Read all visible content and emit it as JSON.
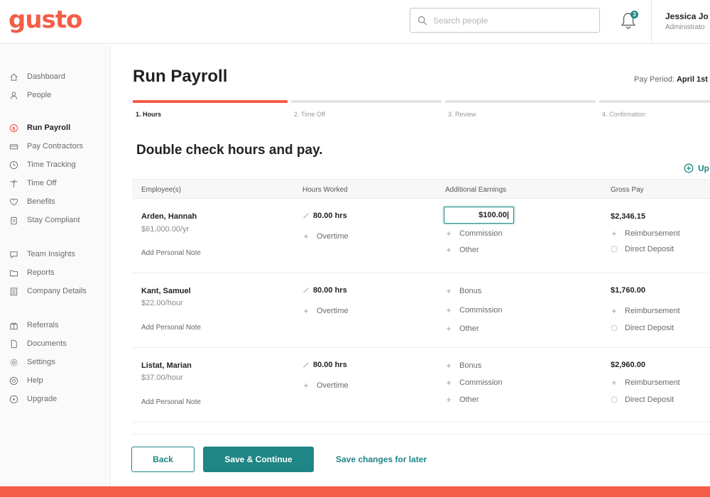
{
  "brand": {
    "logo_text": "gusto",
    "accent": "#f45d48",
    "primary": "#1f8585"
  },
  "header": {
    "search_placeholder": "Search people",
    "notification_count": "3",
    "user_name": "Jessica Jo",
    "user_role": "Administrato"
  },
  "sidebar": {
    "items": [
      {
        "label": "Dashboard",
        "icon": "home-icon"
      },
      {
        "label": "People",
        "icon": "person-icon"
      },
      {
        "label": "Run Payroll",
        "icon": "dollar-icon",
        "active": true
      },
      {
        "label": "Pay Contractors",
        "icon": "card-icon"
      },
      {
        "label": "Time Tracking",
        "icon": "clock-icon"
      },
      {
        "label": "Time Off",
        "icon": "palm-icon"
      },
      {
        "label": "Benefits",
        "icon": "heart-icon"
      },
      {
        "label": "Stay Compliant",
        "icon": "clipboard-icon"
      },
      {
        "label": "Team Insights",
        "icon": "chat-icon"
      },
      {
        "label": "Reports",
        "icon": "folder-icon"
      },
      {
        "label": "Company Details",
        "icon": "building-icon"
      },
      {
        "label": "Referrals",
        "icon": "gift-icon"
      },
      {
        "label": "Documents",
        "icon": "document-icon"
      },
      {
        "label": "Settings",
        "icon": "gear-icon"
      },
      {
        "label": "Help",
        "icon": "help-icon"
      },
      {
        "label": "Upgrade",
        "icon": "upgrade-icon"
      }
    ]
  },
  "main": {
    "title": "Run Payroll",
    "pay_period_label": "Pay Period:",
    "pay_period_value": "April 1st",
    "steps": [
      "1. Hours",
      "2. Time Off",
      "3. Review",
      "4. Confirmation"
    ],
    "active_step": 0,
    "subheading": "Double check hours and pay.",
    "upgrade_link": "Up"
  },
  "table": {
    "headers": [
      "Employee(s)",
      "Hours Worked",
      "Additional Earnings",
      "Gross Pay"
    ],
    "rows": [
      {
        "name": "Arden, Hannah",
        "rate": "$61,000.00/yr",
        "note": "Add Personal Note",
        "hours": "80.00 hrs",
        "overtime": "Overtime",
        "earning_input": "$100.00|",
        "earnings": [
          "Commission",
          "Other"
        ],
        "gross": "$2,346.15",
        "reimbursement": "Reimbursement",
        "deposit": "Direct Deposit"
      },
      {
        "name": "Kant, Samuel",
        "rate": "$22.00/hour",
        "note": "Add Personal Note",
        "hours": "80.00 hrs",
        "overtime": "Overtime",
        "earnings": [
          "Bonus",
          "Commission",
          "Other"
        ],
        "gross": "$1,760.00",
        "reimbursement": "Reimbursement",
        "deposit": "Direct Deposit"
      },
      {
        "name": "Listat, Marian",
        "rate": "$37.00/hour",
        "note": "Add Personal Note",
        "hours": "80.00 hrs",
        "overtime": "Overtime",
        "earnings": [
          "Bonus",
          "Commission",
          "Other"
        ],
        "gross": "$2,960.00",
        "reimbursement": "Reimbursement",
        "deposit": "Direct Deposit"
      }
    ]
  },
  "footer": {
    "back_label": "Back",
    "save_label": "Save & Continue",
    "later_label": "Save changes for later"
  }
}
